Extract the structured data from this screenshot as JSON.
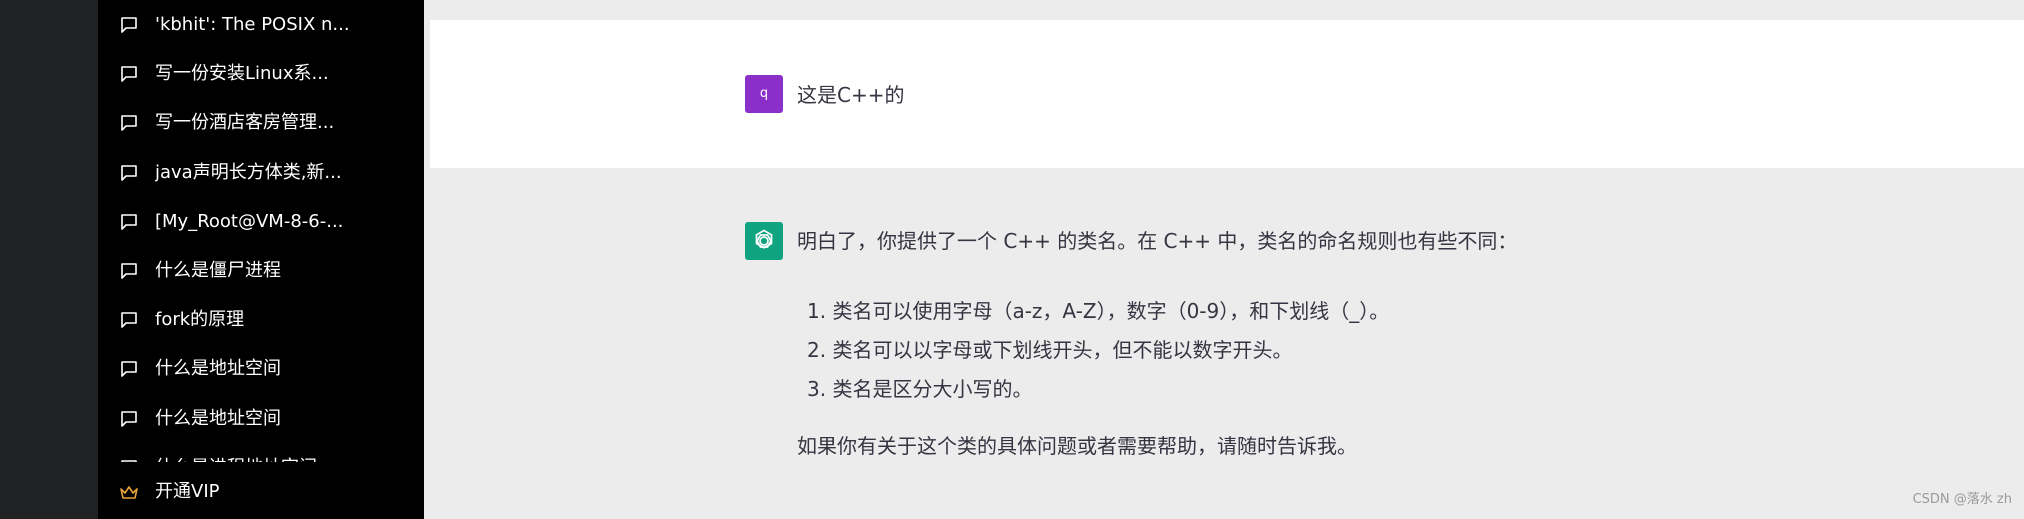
{
  "sidebar": {
    "conversations": [
      {
        "label": "'kbhit': The POSIX n..."
      },
      {
        "label": "写一份安装Linux系..."
      },
      {
        "label": "写一份酒店客房管理..."
      },
      {
        "label": "java声明长方体类,新..."
      },
      {
        "label": "[My_Root@VM-8-6-..."
      },
      {
        "label": "什么是僵尸进程"
      },
      {
        "label": "fork的原理"
      },
      {
        "label": "什么是地址空间"
      },
      {
        "label": "什么是地址空间"
      },
      {
        "label": "什么是进程地址空间"
      }
    ],
    "vip_label": "开通VIP",
    "icons": {
      "conversation": "message-square-icon",
      "vip": "crown-icon"
    },
    "colors": {
      "background": "#000000",
      "vip_icon": "#e8a43a"
    }
  },
  "chat": {
    "user": {
      "avatar_text": "q",
      "avatar_color": "#8b2fc9",
      "message": "这是C++的"
    },
    "assistant": {
      "avatar_icon": "openai-logo-icon",
      "avatar_color": "#10a37f",
      "intro": "明白了，你提供了一个 C++ 的类名。在 C++ 中，类名的命名规则也有些不同：",
      "list": [
        "1. 类名可以使用字母（a-z，A-Z），数字（0-9），和下划线（_）。",
        "2. 类名可以以字母或下划线开头，但不能以数字开头。",
        "3. 类名是区分大小写的。"
      ],
      "outro": "如果你有关于这个类的具体问题或者需要帮助，请随时告诉我。"
    }
  },
  "watermark": "CSDN @落水 zh"
}
